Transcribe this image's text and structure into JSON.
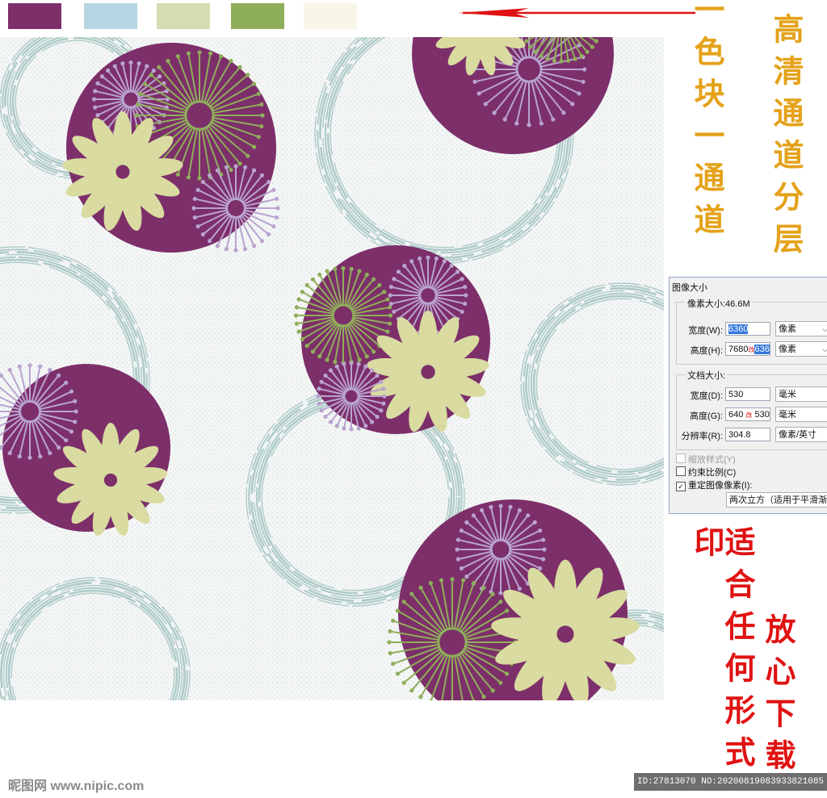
{
  "swatches": [
    "#7d2f6a",
    "#b5d6e2",
    "#d6dcaf",
    "#8fae5a",
    "#f8f6e6"
  ],
  "colors": {
    "plum": "#7d2f6a",
    "sage_ring": "#a6c7c4",
    "leaf_green": "#8fae5a",
    "cream_petal": "#d9dba0",
    "lilac_burst": "#b9a3cf",
    "background": "#f4f6f6"
  },
  "labels": {
    "hd_channels": "高清通道分层",
    "one_color_one_channel": "一色块一通道",
    "fit_any_print": "适合任何形式印",
    "download_safely": "放心下载"
  },
  "dialog": {
    "title": "图像大小",
    "pixel_size_label": "像素大小:46.6M",
    "width_label": "宽度(W):",
    "width_value": "6360",
    "width_unit": "像素",
    "height_label": "高度(H):",
    "height_value_prefix": "7680",
    "height_value_mark": "改",
    "height_value_selected": "6360",
    "height_unit": "像素",
    "doc_size_label": "文档大小:",
    "doc_width_label": "宽度(D):",
    "doc_width_value": "530",
    "doc_width_unit": "毫米",
    "doc_height_label": "高度(G):",
    "doc_height_value_prefix": "640",
    "doc_height_value_mark": "改",
    "doc_height_value_suffix": "530",
    "doc_height_unit": "毫米",
    "resolution_label": "分辨率(R):",
    "resolution_value": "304.8",
    "resolution_unit": "像素/英寸",
    "scale_styles": "缩放样式(Y)",
    "constrain_proportions": "约束比例(C)",
    "resample": "重定图像像素(I):",
    "resample_method": "两次立方（适用于平滑渐变"
  },
  "footer": {
    "left": "昵图网 www.nipic.com",
    "right": "ID:27813070 NO:20200819083933821085"
  }
}
